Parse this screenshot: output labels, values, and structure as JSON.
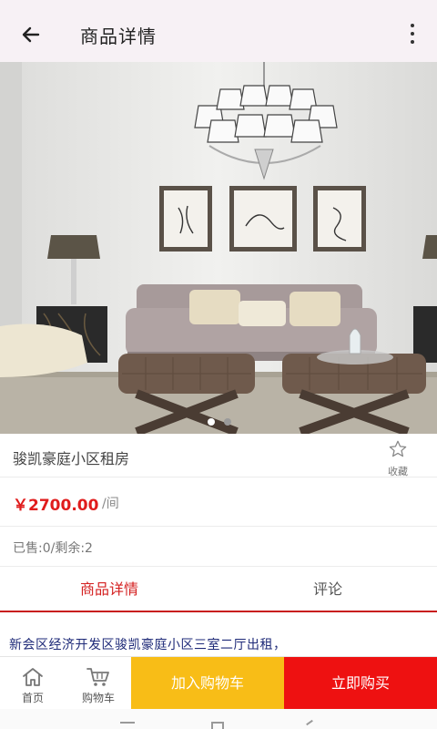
{
  "header": {
    "title": "商品详情",
    "back_icon": "arrow-left-icon",
    "more_icon": "more-vertical-icon"
  },
  "gallery": {
    "image_description": "living-room",
    "slide_count": 2,
    "active_slide": 1
  },
  "product": {
    "title": "骏凯豪庭小区租房",
    "favorite_label": "收藏",
    "price": "￥2700.00",
    "unit": "/间",
    "sales_info": "已售:0/剩余:2",
    "description": "新会区经济开发区骏凯豪庭小区三室二厅出租，"
  },
  "tabs": [
    {
      "label": "商品详情",
      "active": true
    },
    {
      "label": "评论",
      "active": false
    }
  ],
  "bottom_bar": {
    "home_label": "首页",
    "cart_label": "购物车",
    "add_to_cart_label": "加入购物车",
    "buy_now_label": "立即购买"
  },
  "colors": {
    "accent_red": "#e01c1c",
    "add_cart_yellow": "#f8bd17",
    "buy_red": "#ee1111",
    "header_bg": "#f7f1f5"
  }
}
